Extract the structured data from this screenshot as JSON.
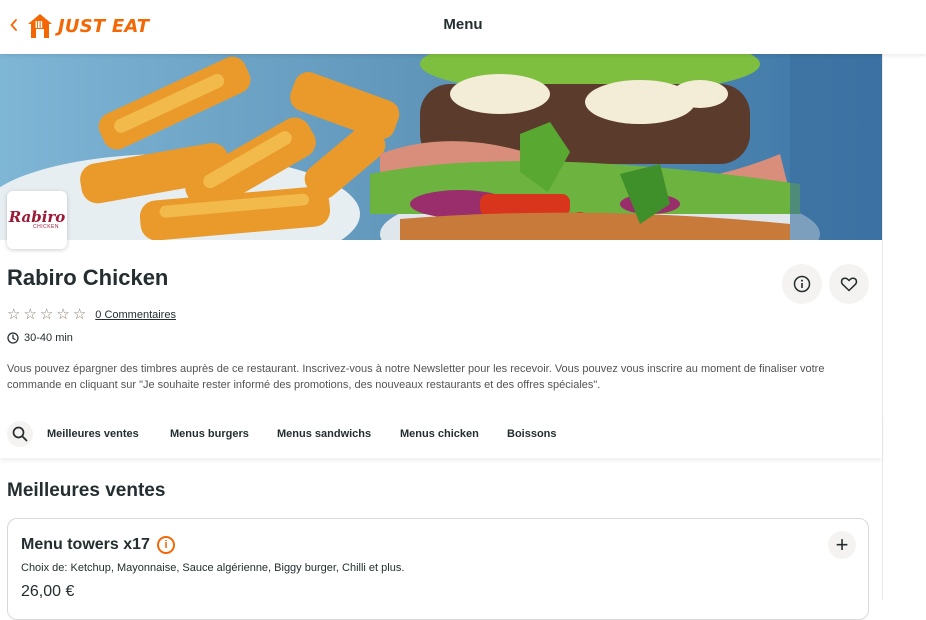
{
  "header": {
    "back_icon": "chevron-left-icon",
    "logo_text": "JUST EAT",
    "title": "Menu"
  },
  "colors": {
    "brand_orange": "#f36805",
    "text": "#242e30",
    "logo_red": "#9b1a36"
  },
  "restaurant": {
    "logo_brand": "Rabiro",
    "logo_sub": "CHICKEN",
    "name": "Rabiro Chicken",
    "rating_stars": 0,
    "reviews_link": "0 Commentaires",
    "delivery_time": "30-40 min",
    "newsletter_text": "Vous pouvez épargner des timbres auprès de ce restaurant. Inscrivez-vous à notre Newsletter pour les recevoir. Vous pouvez vous inscrire au moment de finaliser votre commande en cliquant sur \"Je souhaite rester informé des promotions, des nouveaux restaurants et des offres spéciales\"."
  },
  "categories": [
    "Meilleures ventes",
    "Menus burgers",
    "Menus sandwichs",
    "Menus chicken",
    "Boissons"
  ],
  "section": {
    "title": "Meilleures ventes",
    "items": [
      {
        "name": "Menu towers x17",
        "info_icon": "i",
        "description": "Choix de: Ketchup, Mayonnaise, Sauce algérienne, Biggy burger, Chilli et plus.",
        "price": "26,00 €",
        "add_icon": "+"
      }
    ]
  }
}
